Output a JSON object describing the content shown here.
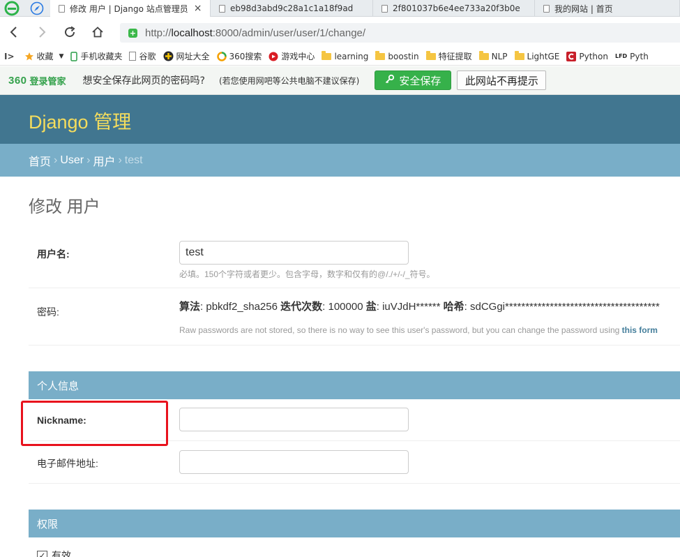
{
  "browser": {
    "tabs": [
      {
        "label": "修改 用户 | Django 站点管理员",
        "active": true
      },
      {
        "label": "eb98d3abd9c28a1c1a18f9ad",
        "active": false
      },
      {
        "label": "2f801037b6e4ee733a20f3b0e",
        "active": false
      },
      {
        "label": "我的网站 | 首页",
        "active": false
      }
    ],
    "tab_close": "×",
    "url_scheme": "http://",
    "url_host": "localhost",
    "url_rest": ":8000/admin/user/user/1/change/",
    "bookmarks": [
      {
        "label": "收藏",
        "icon": "star-icon"
      },
      {
        "label": "手机收藏夹",
        "icon": "phone-icon"
      },
      {
        "label": "谷歌",
        "icon": "page-icon"
      },
      {
        "label": "网址大全",
        "icon": "plus-globe-icon"
      },
      {
        "label": "360搜索",
        "icon": "search360-icon"
      },
      {
        "label": "游戏中心",
        "icon": "game-icon"
      },
      {
        "label": "learning",
        "icon": "folder-icon"
      },
      {
        "label": "boostin",
        "icon": "folder-icon"
      },
      {
        "label": "特征提取",
        "icon": "folder-icon"
      },
      {
        "label": "NLP",
        "icon": "folder-icon"
      },
      {
        "label": "LightGE",
        "icon": "folder-icon"
      },
      {
        "label": "Python",
        "icon": "c-icon"
      },
      {
        "label": "Pyth",
        "icon": "lfd-icon"
      }
    ],
    "bookmarks_more": "I>",
    "lfd_text": "LFD",
    "password_manager": {
      "logo": "360",
      "logo_sub": "登录管家",
      "question": "想安全保存此网页的密码吗?",
      "note": "(若您使用网吧等公共电脑不建议保存)",
      "save_label": "安全保存",
      "never_label": "此网站不再提示"
    },
    "colors": {
      "accent_green": "#36b14a"
    }
  },
  "admin": {
    "site_title": "Django 管理",
    "breadcrumbs": {
      "home": "首页",
      "app": "User",
      "model": "用户",
      "current": "test",
      "sep": "›"
    },
    "page_title": "修改 用户",
    "colors": {
      "header": "#417690",
      "breadcrumbs": "#79aec8",
      "title": "#f5dd5d"
    },
    "username": {
      "label": "用户名:",
      "value": "test",
      "help": "必填。150个字符或者更少。包含字母，数字和仅有的@/./+/-/_符号。"
    },
    "password": {
      "label": "密码:",
      "algorithm_label": "算法",
      "algorithm": "pbkdf2_sha256",
      "iterations_label": "迭代次数",
      "iterations": "100000",
      "salt_label": "盐",
      "salt": "iuVJdH******",
      "hash_label": "哈希",
      "hash": "sdCGgi**************************************",
      "help": "Raw passwords are not stored, so there is no way to see this user's password, but you can change the password using ",
      "help_link": "this form"
    },
    "personal_info": {
      "heading": "个人信息",
      "nickname_label": "Nickname:",
      "nickname_value": "",
      "email_label": "电子邮件地址:",
      "email_value": ""
    },
    "permissions": {
      "heading": "权限",
      "active_label": "有效",
      "active_checked": true
    }
  }
}
